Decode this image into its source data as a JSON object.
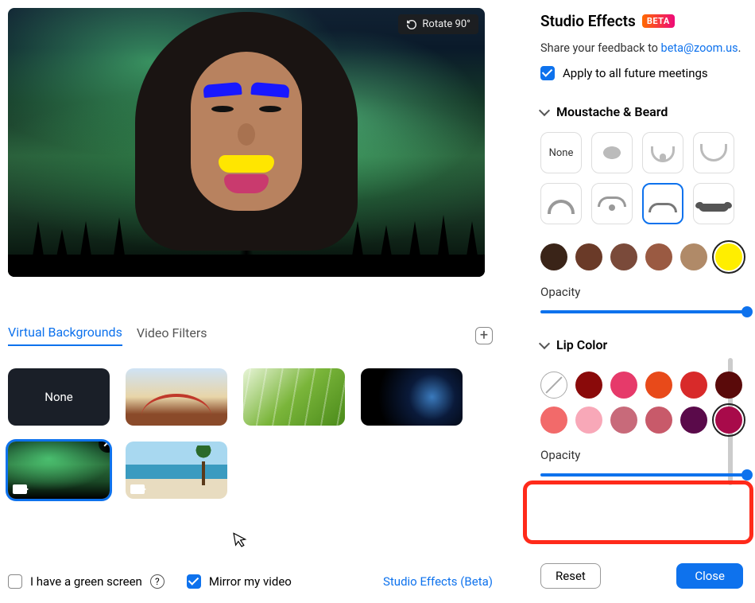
{
  "preview": {
    "rotate_label": "Rotate 90°"
  },
  "tabs": {
    "virtual_bg": "Virtual Backgrounds",
    "filters": "Video Filters"
  },
  "bg": {
    "none": "None"
  },
  "bottom": {
    "green": "I have a green screen",
    "mirror": "Mirror my video",
    "studio_link": "Studio Effects (Beta)"
  },
  "panel": {
    "title": "Studio Effects",
    "beta": "BETA",
    "feedback_prefix": "Share your feedback to  ",
    "feedback_email": "beta@zoom.us",
    "apply_all": "Apply to all future meetings"
  },
  "moustache": {
    "heading": "Moustache & Beard",
    "none": "None",
    "colors": [
      "#3a2418",
      "#6a3a28",
      "#7a4a3a",
      "#9a5a42",
      "#b08a68",
      "#ffee00"
    ],
    "selected_color_index": 5,
    "opacity_label": "Opacity",
    "opacity_value": 100
  },
  "lip": {
    "heading": "Lip Color",
    "colors_row1": [
      "none",
      "#8a0a0a",
      "#e63a6a",
      "#e84a1a",
      "#d82a2a",
      "#5a0a0a"
    ],
    "colors_row2": [
      "#f26a6a",
      "#f8a8b8",
      "#c86a7a",
      "#c85a6a",
      "#5a0a4a",
      "#a80a4a"
    ],
    "selected_index": 11,
    "opacity_label": "Opacity",
    "opacity_value": 100
  },
  "footer": {
    "reset": "Reset",
    "close": "Close"
  }
}
